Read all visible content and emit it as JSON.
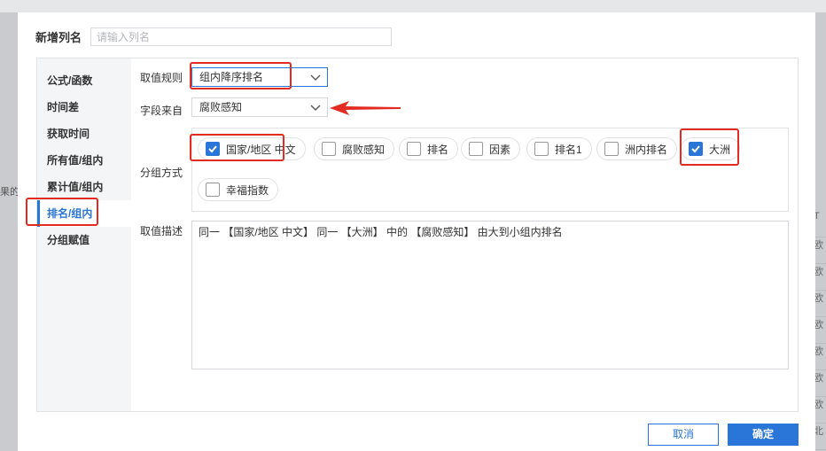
{
  "dialog": {
    "title": "新增列名",
    "name_placeholder": "请输入列名"
  },
  "sidebar": {
    "items": [
      {
        "label": "公式/函数"
      },
      {
        "label": "时间差"
      },
      {
        "label": "获取时间"
      },
      {
        "label": "所有值/组内"
      },
      {
        "label": "累计值/组内"
      },
      {
        "label": "排名/组内",
        "active": true
      },
      {
        "label": "分组赋值"
      }
    ]
  },
  "form": {
    "rule_label": "取值规则",
    "rule_value": "组内降序排名",
    "field_label": "字段来自",
    "field_value": "腐败感知",
    "group_label": "分组方式",
    "group_options": [
      {
        "label": "国家/地区 中文",
        "checked": true
      },
      {
        "label": "腐败感知",
        "checked": false
      },
      {
        "label": "排名",
        "checked": false
      },
      {
        "label": "因素",
        "checked": false
      },
      {
        "label": "排名1",
        "checked": false
      },
      {
        "label": "洲内排名",
        "checked": false
      },
      {
        "label": "大洲",
        "checked": true
      },
      {
        "label": "幸福指数",
        "checked": false
      }
    ],
    "desc_label": "取值描述",
    "desc_text": "同一 【国家/地区 中文】 同一 【大洲】 中的 【腐败感知】 由大到小组内排名"
  },
  "footer": {
    "cancel_label": "取消",
    "ok_label": "确定"
  },
  "background": {
    "left_text": "果的",
    "right_col": [
      "T",
      "欧",
      "欧",
      "欧",
      "欧",
      "欧",
      "欧",
      "欧",
      "北"
    ]
  },
  "colors": {
    "accent": "#2a76d8",
    "annotation_red": "#e22b22"
  }
}
